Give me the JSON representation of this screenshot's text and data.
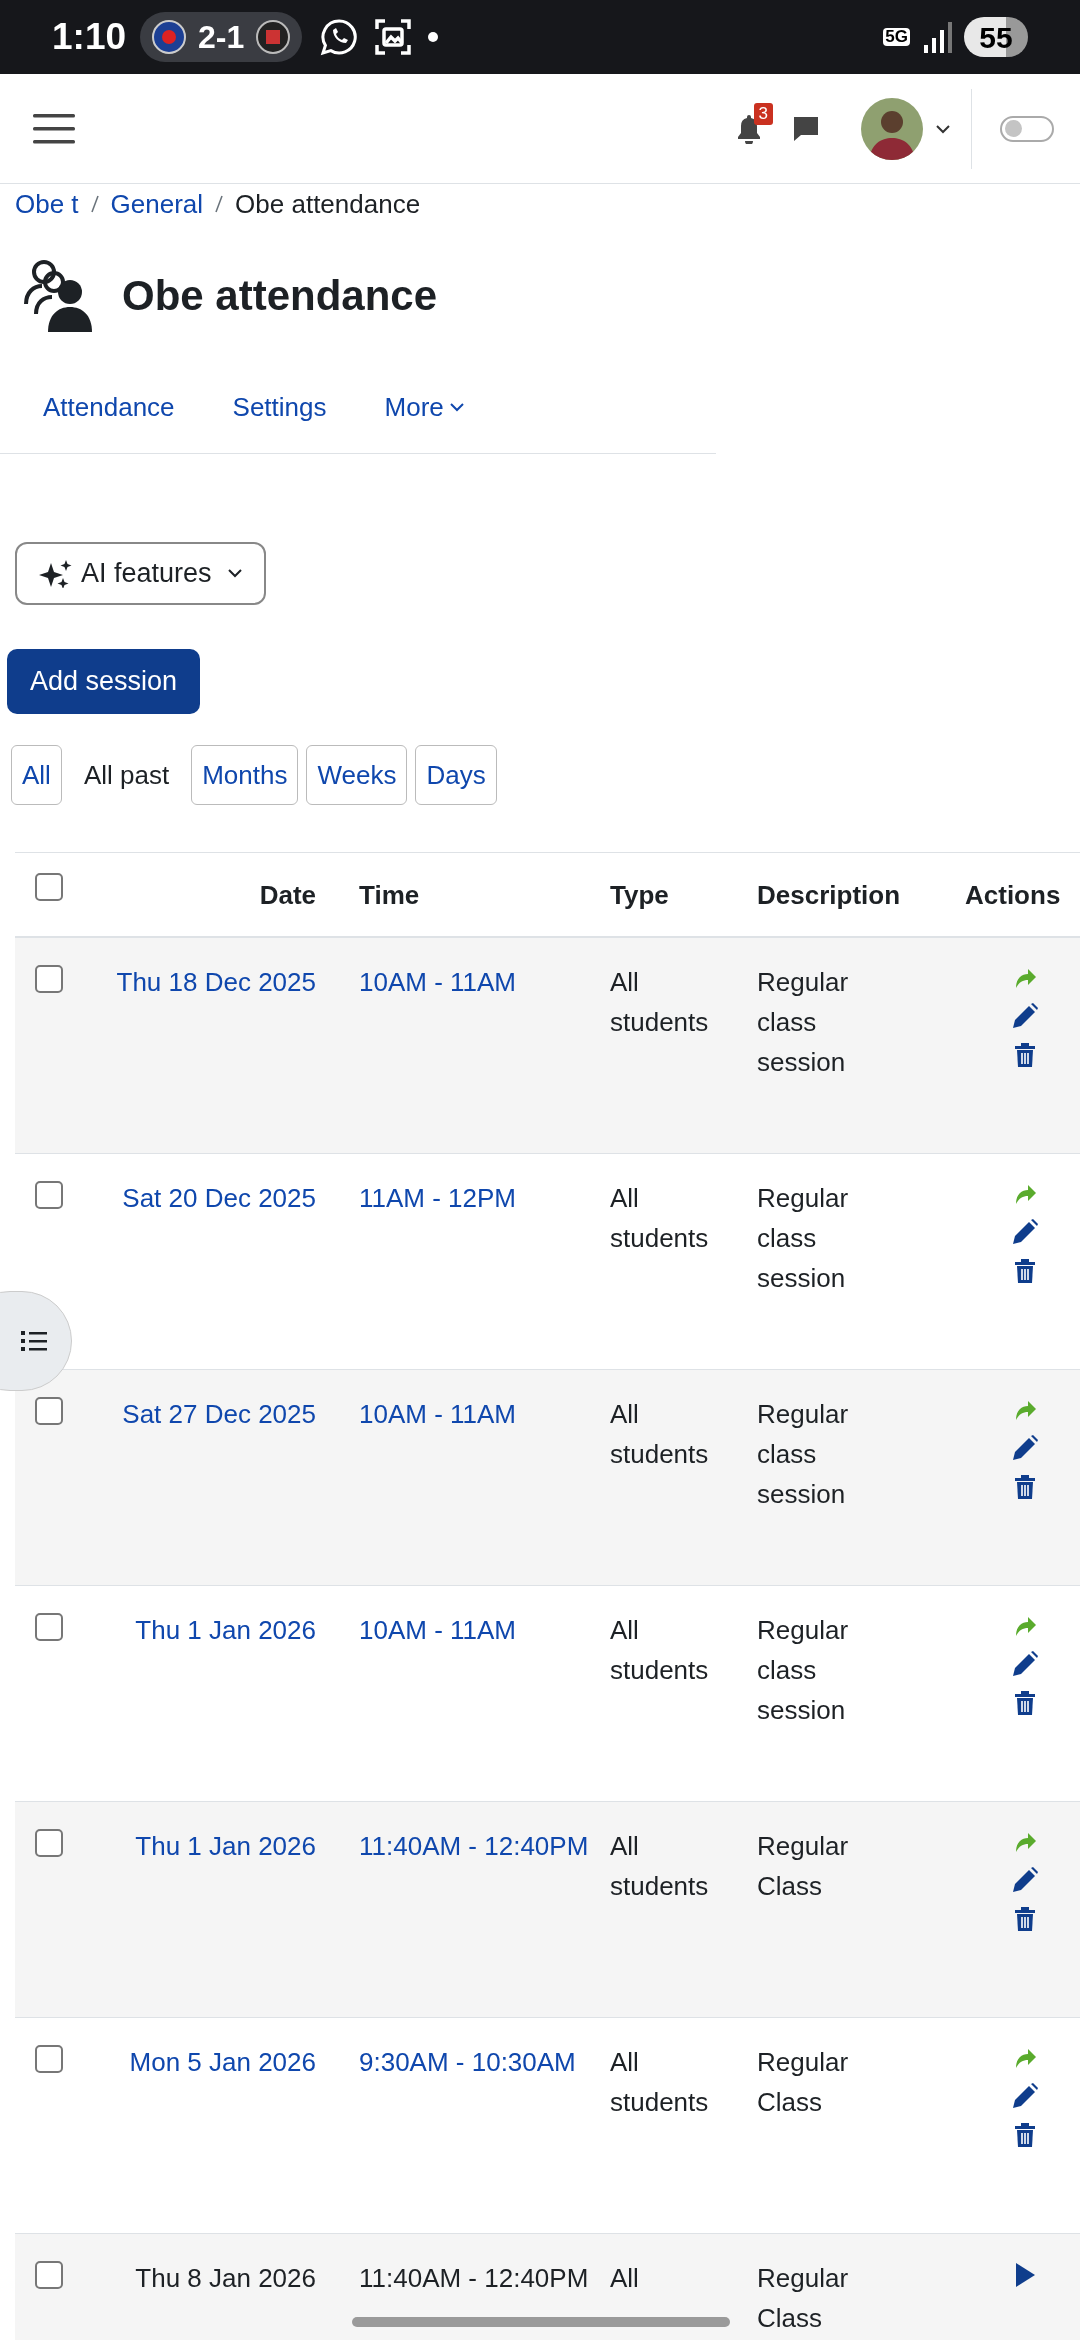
{
  "status_bar": {
    "time": "1:10",
    "score": "2-1",
    "network": "5G",
    "battery": "55"
  },
  "header": {
    "notification_count": "3",
    "dark_mode": false
  },
  "breadcrumb": [
    "Obe t",
    "General",
    "Obe attendance"
  ],
  "page_title": "Obe attendance",
  "tabs": [
    {
      "label": "Attendance",
      "dropdown": false
    },
    {
      "label": "Settings",
      "dropdown": false
    },
    {
      "label": "More",
      "dropdown": true
    }
  ],
  "ai_button": "AI features",
  "add_button": "Add session",
  "filters": [
    {
      "label": "All",
      "selected": false
    },
    {
      "label": "All past",
      "selected": true
    },
    {
      "label": "Months",
      "selected": false
    },
    {
      "label": "Weeks",
      "selected": false
    },
    {
      "label": "Days",
      "selected": false
    }
  ],
  "table": {
    "columns": [
      "Date",
      "Time",
      "Type",
      "Description",
      "Actions"
    ],
    "all_checked": false,
    "rows": [
      {
        "date": "Thu 18 Dec 2025",
        "time": "10AM - 11AM",
        "type": "All students",
        "description": "Regular class session",
        "linked": true,
        "checked": false,
        "actions": [
          {
            "kind": "take"
          },
          {
            "kind": "edit"
          },
          {
            "kind": "delete"
          }
        ]
      },
      {
        "date": "Sat 20 Dec 2025",
        "time": "11AM - 12PM",
        "type": "All students",
        "description": "Regular class session",
        "linked": true,
        "checked": false,
        "actions": [
          {
            "kind": "take"
          },
          {
            "kind": "edit"
          },
          {
            "kind": "delete"
          }
        ]
      },
      {
        "date": "Sat 27 Dec 2025",
        "time": "10AM - 11AM",
        "type": "All students",
        "description": "Regular class session",
        "linked": true,
        "checked": false,
        "actions": [
          {
            "kind": "take"
          },
          {
            "kind": "edit"
          },
          {
            "kind": "delete"
          }
        ]
      },
      {
        "date": "Thu 1 Jan 2026",
        "time": "10AM - 11AM",
        "type": "All students",
        "description": "Regular class session",
        "linked": true,
        "checked": false,
        "actions": [
          {
            "kind": "take"
          },
          {
            "kind": "edit"
          },
          {
            "kind": "delete"
          }
        ]
      },
      {
        "date": "Thu 1 Jan 2026",
        "time": "11:40AM - 12:40PM",
        "type": "All students",
        "description": "Regular Class",
        "linked": true,
        "checked": false,
        "actions": [
          {
            "kind": "take"
          },
          {
            "kind": "edit"
          },
          {
            "kind": "delete"
          }
        ]
      },
      {
        "date": "Mon 5 Jan 2026",
        "time": "9:30AM - 10:30AM",
        "type": "All students",
        "description": "Regular Class",
        "linked": true,
        "checked": false,
        "actions": [
          {
            "kind": "take"
          },
          {
            "kind": "edit"
          },
          {
            "kind": "delete"
          }
        ]
      },
      {
        "date": "Thu 8 Jan 2026",
        "time": "11:40AM - 12:40PM",
        "type": "All",
        "description": "Regular Class",
        "linked": false,
        "checked": false,
        "actions": [
          {
            "kind": "start"
          }
        ]
      }
    ]
  }
}
